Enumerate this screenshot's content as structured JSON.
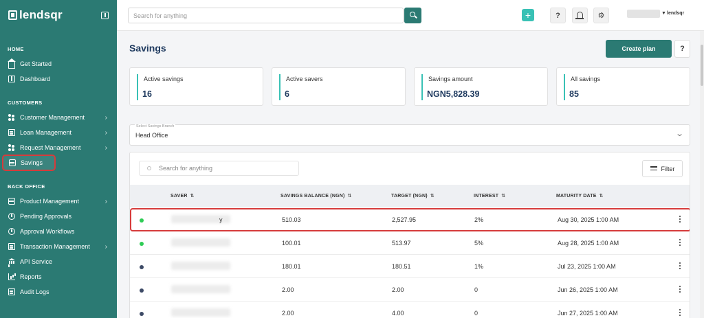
{
  "brand": {
    "name": "lendsqr",
    "mini": "lendsqr"
  },
  "sidebar": {
    "sections": {
      "home": "HOME",
      "customers": "CUSTOMERS",
      "back_office": "BACK OFFICE"
    },
    "items": {
      "get_started": "Get Started",
      "dashboard": "Dashboard",
      "customer_management": "Customer Management",
      "loan_management": "Loan Management",
      "request_management": "Request Management",
      "savings": "Savings",
      "product_management": "Product Management",
      "pending_approvals": "Pending Approvals",
      "approval_workflows": "Approval Workflows",
      "transaction_management": "Transaction Management",
      "api_service": "API Service",
      "reports": "Reports",
      "audit_logs": "Audit Logs"
    }
  },
  "topbar": {
    "search_placeholder": "Search for anything",
    "plus_label": "+",
    "help_label": "?"
  },
  "page": {
    "title": "Savings",
    "create_label": "Create plan",
    "help_label": "?"
  },
  "stats": [
    {
      "label": "Active savings",
      "value": "16"
    },
    {
      "label": "Active savers",
      "value": "6"
    },
    {
      "label": "Savings amount",
      "value": "NGN5,828.39"
    },
    {
      "label": "All savings",
      "value": "85"
    }
  ],
  "branch": {
    "caption": "Select Savings Branch",
    "value": "Head Office"
  },
  "table": {
    "search_placeholder": "Search for anything",
    "filter_label": "Filter",
    "columns": {
      "saver": "SAVER",
      "balance": "SAVINGS BALANCE (NGN)",
      "target": "TARGET (NGN)",
      "interest": "INTEREST",
      "maturity": "MATURITY DATE"
    },
    "rows": [
      {
        "status_color": "#2ecc55",
        "saver_suffix": "y",
        "balance": "510.03",
        "target": "2,527.95",
        "interest": "2%",
        "maturity": "Aug 30, 2025 1:00 AM"
      },
      {
        "status_color": "#2ecc55",
        "saver_suffix": "",
        "balance": "100.01",
        "target": "513.97",
        "interest": "5%",
        "maturity": "Aug 28, 2025 1:00 AM"
      },
      {
        "status_color": "#3d4a66",
        "saver_suffix": "",
        "balance": "180.01",
        "target": "180.51",
        "interest": "1%",
        "maturity": "Jul 23, 2025 1:00 AM"
      },
      {
        "status_color": "#3d4a66",
        "saver_suffix": "",
        "balance": "2.00",
        "target": "2.00",
        "interest": "0",
        "maturity": "Jun 26, 2025 1:00 AM"
      },
      {
        "status_color": "#3d4a66",
        "saver_suffix": "",
        "balance": "2.00",
        "target": "4.00",
        "interest": "0",
        "maturity": "Jun 27, 2025 1:00 AM"
      }
    ]
  }
}
